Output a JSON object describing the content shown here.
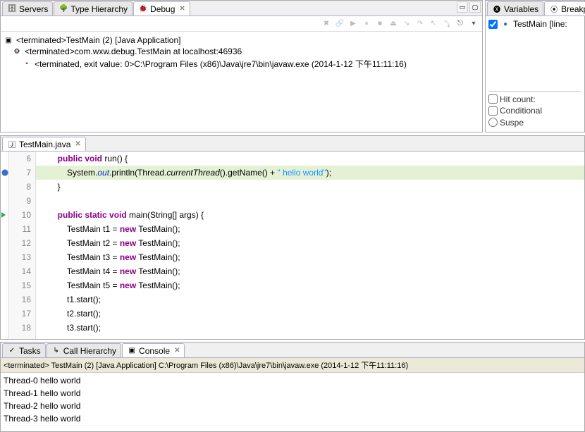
{
  "debugPane": {
    "tabs": {
      "servers": "Servers",
      "typeHierarchy": "Type Hierarchy",
      "debug": "Debug"
    },
    "tree": {
      "root": "<terminated>TestMain (2) [Java Application]",
      "l1": "<terminated>com.wxw.debug.TestMain at localhost:46936",
      "l2": "<terminated, exit value: 0>C:\\Program Files (x86)\\Java\\jre7\\bin\\javaw.exe (2014-1-12 下午11:11:16)"
    }
  },
  "varsPane": {
    "tabs": {
      "variables": "Variables",
      "breakpoints": "Breakp"
    },
    "bpItem": "TestMain [line:",
    "hitCount": "Hit count:",
    "conditional": "Conditional",
    "suspend": "Suspe"
  },
  "editor": {
    "tab": "TestMain.java",
    "lines": [
      6,
      7,
      8,
      9,
      10,
      11,
      12,
      13,
      14,
      15,
      16,
      17,
      18
    ],
    "code": {
      "l6": {
        "indent": "        ",
        "pre": "public void",
        "rest": " run() {"
      },
      "l7": {
        "indent": "            ",
        "a": "System.",
        "b": "out",
        "c": ".println(Thread.",
        "d": "currentThread",
        "e": "().getName() + ",
        "f": "\" hello world\"",
        "g": ");"
      },
      "l8": "        }",
      "l9": "",
      "l10": {
        "indent": "        ",
        "pre": "public static void",
        "rest": " main(String[] args) {"
      },
      "new": "new",
      "decl11": "            TestMain t1 = ",
      "after": " TestMain();",
      "decl12": "            TestMain t2 = ",
      "decl13": "            TestMain t3 = ",
      "decl14": "            TestMain t4 = ",
      "decl15": "            TestMain t5 = ",
      "l16": "            t1.start();",
      "l17": "            t2.start();",
      "l18": "            t3.start();"
    }
  },
  "console": {
    "tabs": {
      "tasks": "Tasks",
      "callHierarchy": "Call Hierarchy",
      "console": "Console"
    },
    "title": "<terminated> TestMain (2) [Java Application] C:\\Program Files (x86)\\Java\\jre7\\bin\\javaw.exe (2014-1-12 下午11:11:16)",
    "lines": [
      "Thread-0 hello world",
      "Thread-1 hello world",
      "Thread-2 hello world",
      "Thread-3 hello world"
    ]
  }
}
